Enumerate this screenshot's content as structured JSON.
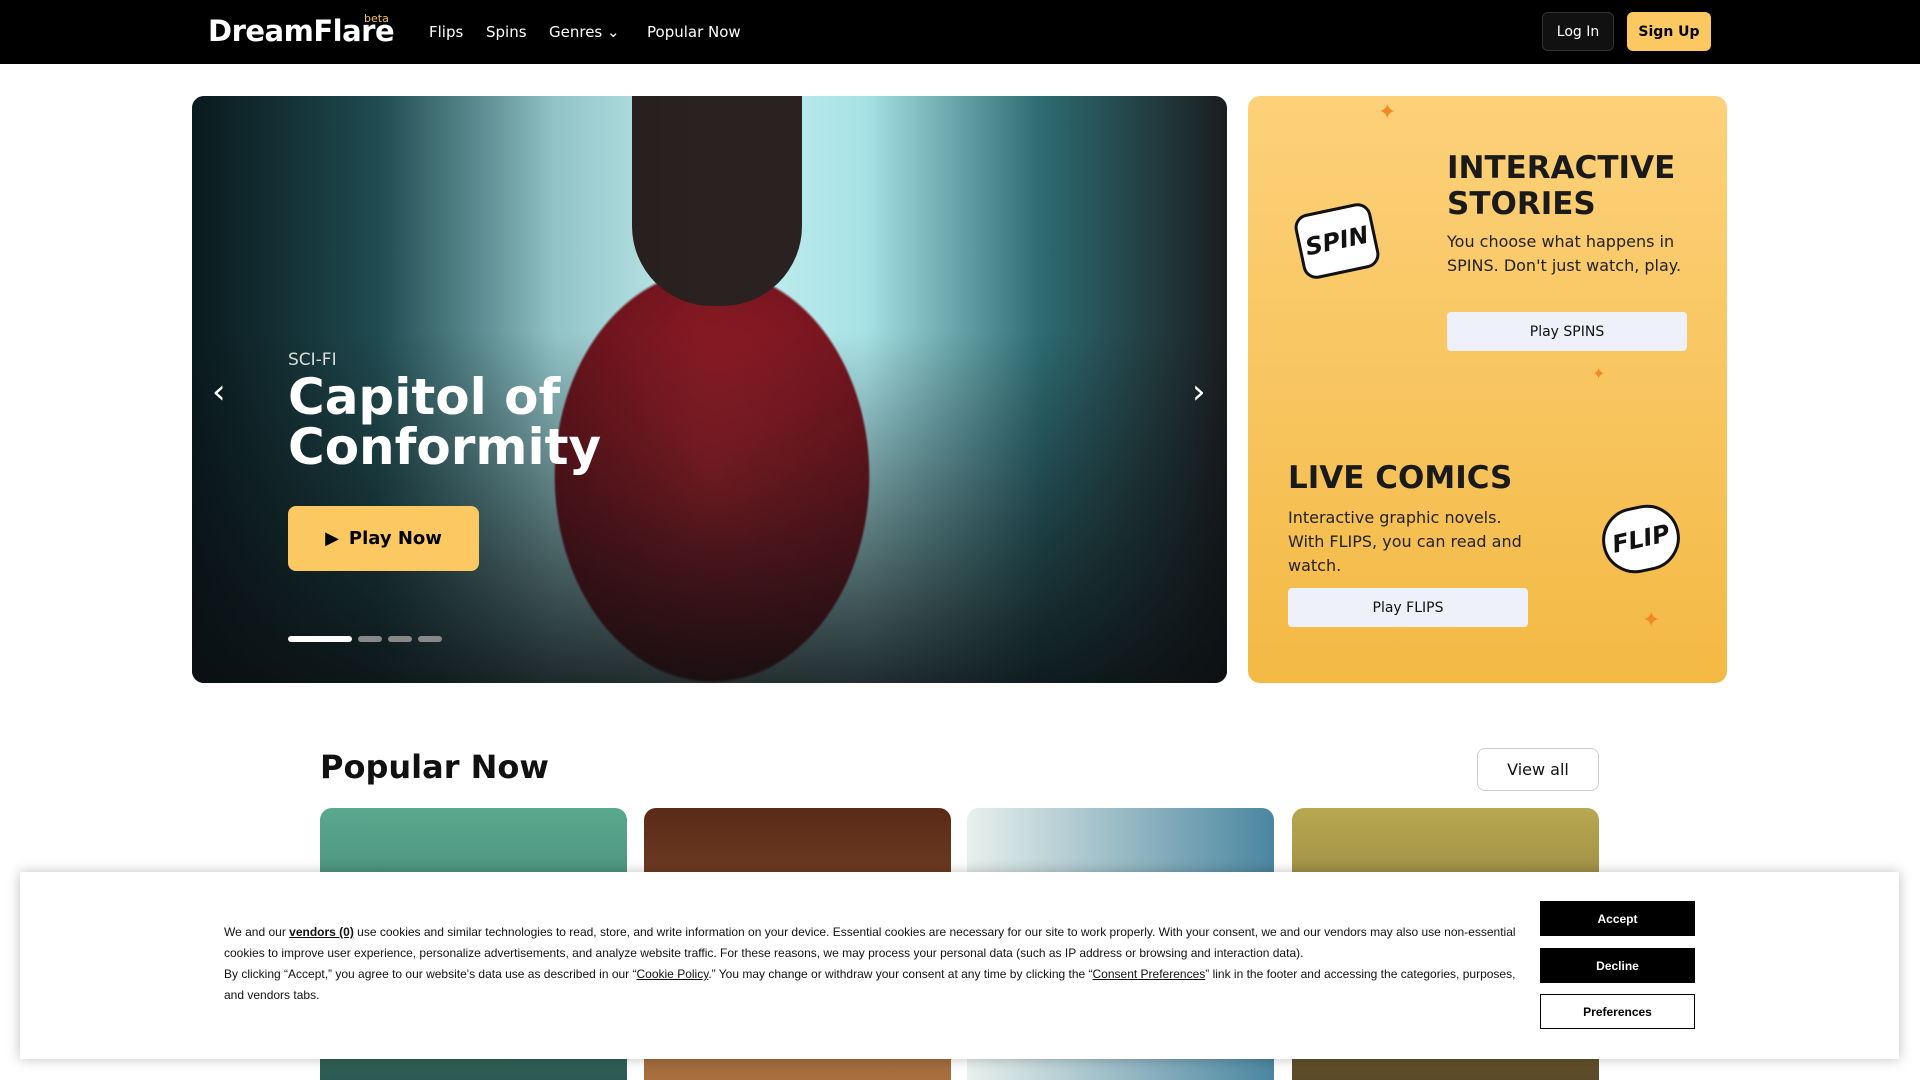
{
  "nav": {
    "logo": "DreamFlare",
    "beta": "beta",
    "links": [
      "Flips",
      "Spins",
      "Genres",
      "Popular Now"
    ],
    "login": "Log In",
    "signup": "Sign Up"
  },
  "hero": {
    "genre": "SCI-FI",
    "title": "Capitol of Conformity",
    "play": "Play Now",
    "slides": 4,
    "active_slide": 1
  },
  "side": {
    "spins_title": "INTERACTIVE STORIES",
    "spins_text": "You choose what happens in SPINS. Don't just watch, play.",
    "spins_btn": "Play SPINS",
    "spin_badge": "SPIN",
    "flips_title": "LIVE COMICS",
    "flips_text": "Interactive graphic novels. With FLIPS, you can read and watch.",
    "flips_btn": "Play FLIPS",
    "flip_badge": "FLIP"
  },
  "popular": {
    "title": "Popular Now",
    "view_all": "View all"
  },
  "cookie": {
    "t1": "We and our ",
    "vendors": "vendors (0)",
    "t2": " use cookies and similar technologies to read, store, and write information on your device. Essential cookies are necessary for our site to work properly. With your consent, we and our vendors may also use non-essential cookies to improve user experience, personalize advertisements, and analyze website traffic. For these reasons, we may process your personal data (such as IP address or browsing and interaction data).",
    "t3": "By clicking “Accept,” you agree to our website's data use as described in our “",
    "cookie_policy": "Cookie Policy",
    "t4": ".” You may change or withdraw your consent at any time by clicking the “",
    "consent_prefs": "Consent Preferences",
    "t5": "” link in the footer and accessing the categories, purposes, and vendors tabs.",
    "accept": "Accept",
    "decline": "Decline",
    "preferences": "Preferences"
  }
}
